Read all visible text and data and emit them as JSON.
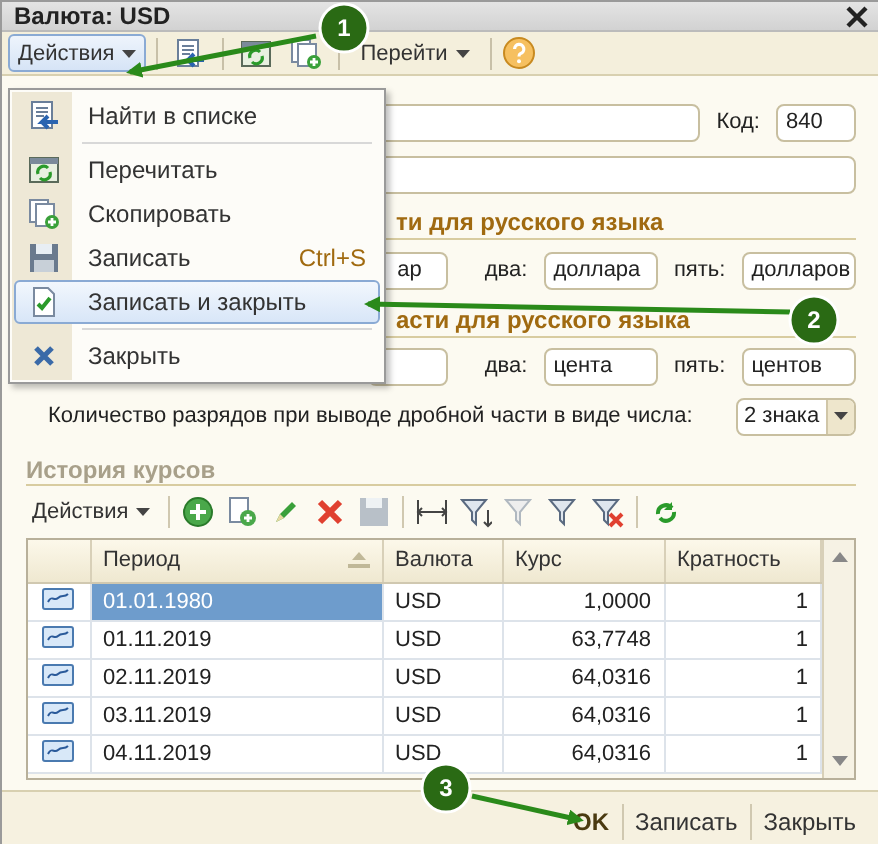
{
  "window": {
    "title": "Валюта: USD"
  },
  "toolbar": {
    "actions": {
      "label": "Действия",
      "pressed": true
    },
    "goto": "Перейти"
  },
  "actions_menu": {
    "items": [
      {
        "kind": "find",
        "label": "Найти в списке",
        "selected": false
      },
      {
        "kind": "separator"
      },
      {
        "kind": "reread",
        "label": "Перечитать",
        "selected": false
      },
      {
        "kind": "copy",
        "label": "Скопировать",
        "selected": false
      },
      {
        "kind": "save",
        "label": "Записать",
        "shortcut": "Ctrl+S",
        "selected": false
      },
      {
        "kind": "save_close",
        "label": "Записать и закрыть",
        "selected": true
      },
      {
        "kind": "separator"
      },
      {
        "kind": "close",
        "label": "Закрыть",
        "selected": false
      }
    ]
  },
  "form": {
    "code_label": "Код:",
    "code": "840",
    "section_1": "ти для русского языка",
    "row_1": {
      "one": "ар",
      "two_label": "два:",
      "two": "доллара",
      "five_label": "пять:",
      "five": "долларов"
    },
    "section_2": "асти для русского языка",
    "row_2": {
      "two_label": "два:",
      "two": "цента",
      "five_label": "пять:",
      "five": "центов"
    },
    "decimals_label": "Количество разрядов при выводе дробной части в виде числа:",
    "decimals": "2 знака"
  },
  "history": {
    "title": "История курсов",
    "actions": "Действия",
    "table": {
      "columns": [
        {
          "label": "Период",
          "sorted": true
        },
        {
          "label": "Валюта",
          "sorted": false
        },
        {
          "label": "Курс",
          "sorted": false
        },
        {
          "label": "Кратность",
          "sorted": false
        }
      ],
      "rows": [
        {
          "cells": [
            "01.01.1980",
            "USD",
            "1,0000",
            "1"
          ],
          "selected": true
        },
        {
          "cells": [
            "01.11.2019",
            "USD",
            "63,7748",
            "1"
          ],
          "selected": false
        },
        {
          "cells": [
            "02.11.2019",
            "USD",
            "64,0316",
            "1"
          ],
          "selected": false
        },
        {
          "cells": [
            "03.11.2019",
            "USD",
            "64,0316",
            "1"
          ],
          "selected": false
        },
        {
          "cells": [
            "04.11.2019",
            "USD",
            "64,0316",
            "1"
          ],
          "selected": false
        }
      ]
    }
  },
  "footer": {
    "buttons": [
      {
        "label": "OK",
        "default": true
      },
      {
        "label": "Записать",
        "default": false
      },
      {
        "label": "Закрыть",
        "default": false
      }
    ]
  },
  "callouts": [
    {
      "number": "1"
    },
    {
      "number": "2"
    },
    {
      "number": "3"
    }
  ]
}
